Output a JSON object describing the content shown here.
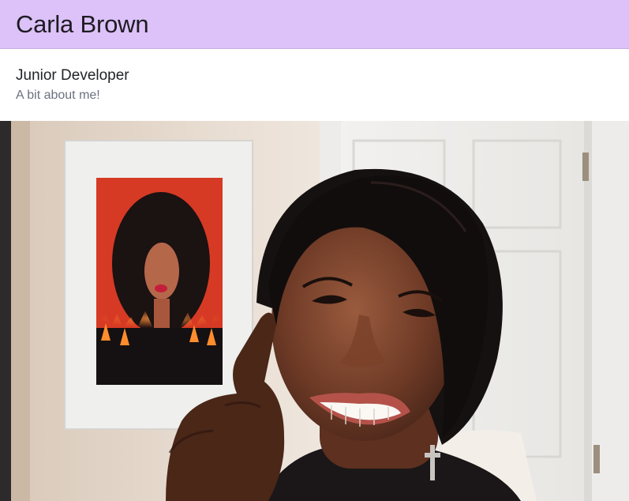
{
  "header": {
    "name": "Carla Brown"
  },
  "profile": {
    "title": "Junior Developer",
    "subtitle": "A bit about me!"
  },
  "photo": {
    "alt": "Carla Brown"
  },
  "colors": {
    "header_bg": "#dcc2f8",
    "title_text": "#1f2328",
    "subtitle_text": "#6b7280"
  }
}
